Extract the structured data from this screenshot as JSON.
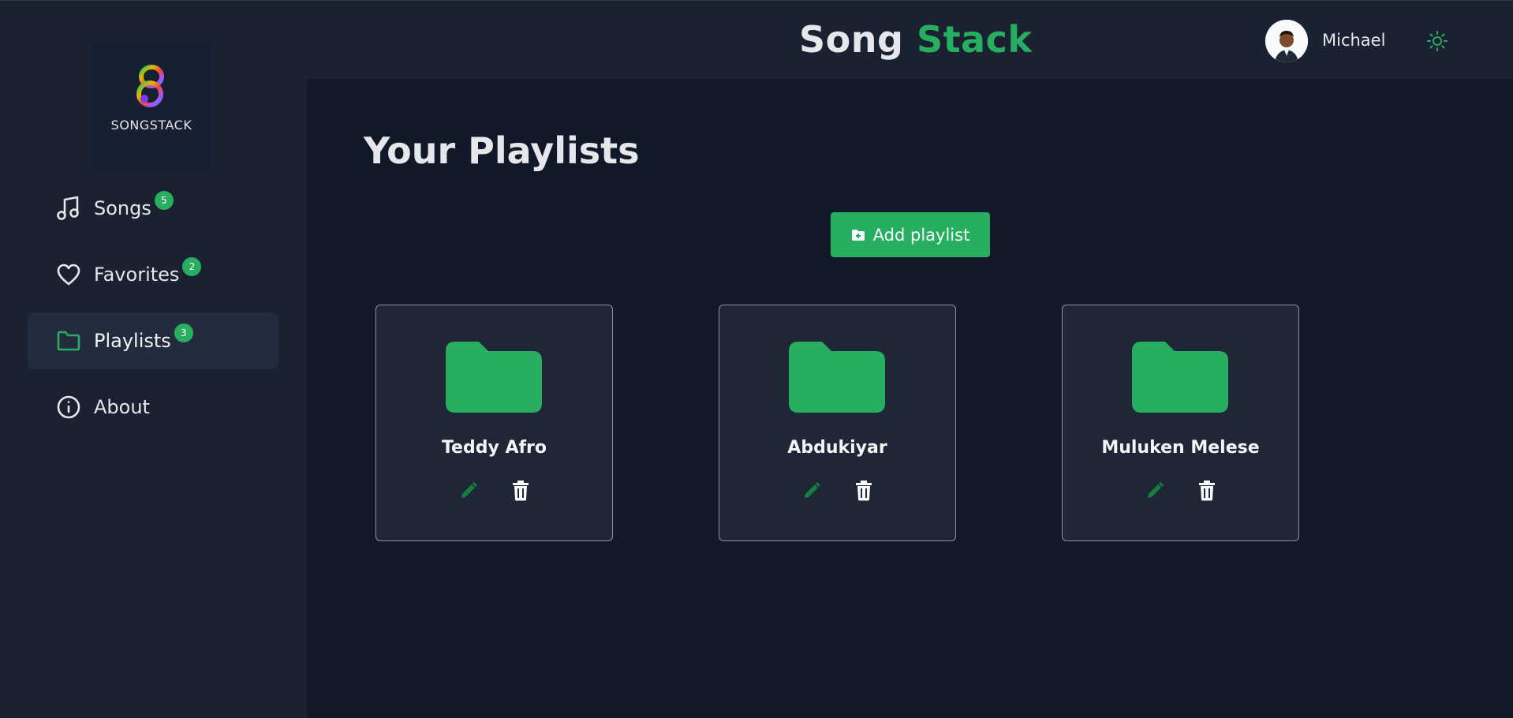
{
  "sidebar": {
    "logo_text": "SONGSTACK",
    "items": [
      {
        "label": "Songs",
        "badge": "5",
        "icon": "music-note-icon",
        "active": false
      },
      {
        "label": "Favorites",
        "badge": "2",
        "icon": "heart-icon",
        "active": false
      },
      {
        "label": "Playlists",
        "badge": "3",
        "icon": "folder-icon",
        "active": true
      },
      {
        "label": "About",
        "badge": null,
        "icon": "info-icon",
        "active": false
      }
    ]
  },
  "header": {
    "brand_part1": "Song",
    "brand_part2": "Stack",
    "user_name": "Michael",
    "theme_icon": "sun-icon"
  },
  "main": {
    "title": "Your Playlists",
    "add_button_label": "Add playlist",
    "add_button_icon": "folder-plus-icon",
    "playlists": [
      {
        "name": "Teddy Afro"
      },
      {
        "name": "Abdukiyar"
      },
      {
        "name": "Muluken Melese"
      }
    ]
  },
  "colors": {
    "accent": "#27ae60",
    "background": "#111827",
    "sidebar": "#1a2232",
    "card": "#1f2737",
    "edit_icon": "#15803d"
  }
}
